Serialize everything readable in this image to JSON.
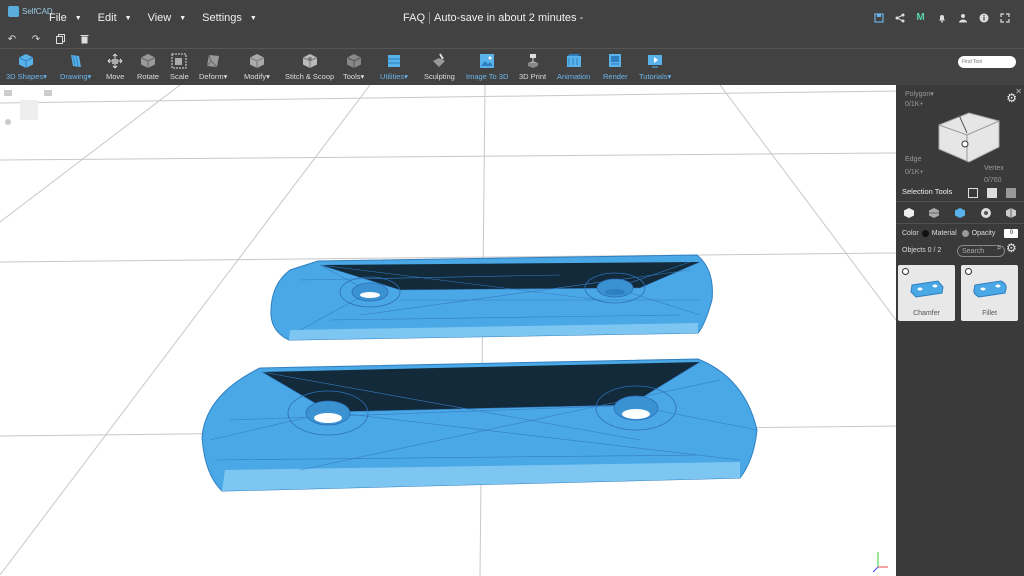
{
  "app": {
    "logo_text": "SelfCAD"
  },
  "menu": [
    {
      "label": "File"
    },
    {
      "label": "Edit"
    },
    {
      "label": "View"
    },
    {
      "label": "Settings"
    }
  ],
  "title": {
    "faq": "FAQ",
    "autosave": "Auto-save in about 2 minutes -"
  },
  "top_icons": [
    "save-icon",
    "share-icon",
    "m-icon",
    "bell-icon",
    "user-icon",
    "info-icon",
    "fullscreen-icon"
  ],
  "quick_icons": [
    "undo-icon",
    "redo-icon",
    "copy-icon",
    "trash-icon"
  ],
  "toolbar": [
    {
      "label": "3D Shapes",
      "dropdown": true,
      "blue": true
    },
    {
      "label": "Drawing",
      "dropdown": true,
      "blue": true
    },
    {
      "label": "Move"
    },
    {
      "label": "Rotate"
    },
    {
      "label": "Scale"
    },
    {
      "label": "Deform",
      "dropdown": true
    },
    {
      "label": "Modify",
      "dropdown": true
    },
    {
      "label": "Stitch & Scoop"
    },
    {
      "label": "Tools",
      "dropdown": true
    },
    {
      "label": "Utilities",
      "dropdown": true,
      "blue": true
    },
    {
      "label": "Sculpting"
    },
    {
      "label": "Image To 3D",
      "blue": true
    },
    {
      "label": "3D Print"
    },
    {
      "label": "Animation",
      "blue": true
    },
    {
      "label": "Render",
      "blue": true
    },
    {
      "label": "Tutorials",
      "dropdown": true,
      "blue": true
    }
  ],
  "find_tool": {
    "placeholder": "Find Tool"
  },
  "panel": {
    "polygon_label": "Polygon",
    "polygon_count": "0/1K+",
    "edge_label": "Edge",
    "edge_count": "0/1K+",
    "vertex_label": "Vertex",
    "vertex_count": "0/760",
    "selection_tools": "Selection Tools",
    "color_label": "Color",
    "material_label": "Material",
    "opacity_label": "Opacity",
    "opacity_value": "0",
    "objects_label": "Objects 0 / 2",
    "search_placeholder": "Search",
    "objects": [
      {
        "name": "Chamfer"
      },
      {
        "name": "Fillet"
      }
    ]
  },
  "colors": {
    "bar": "#424242",
    "panel": "#3a3a3a",
    "accent": "#6cb4ea",
    "model": "#4aa8e6"
  }
}
